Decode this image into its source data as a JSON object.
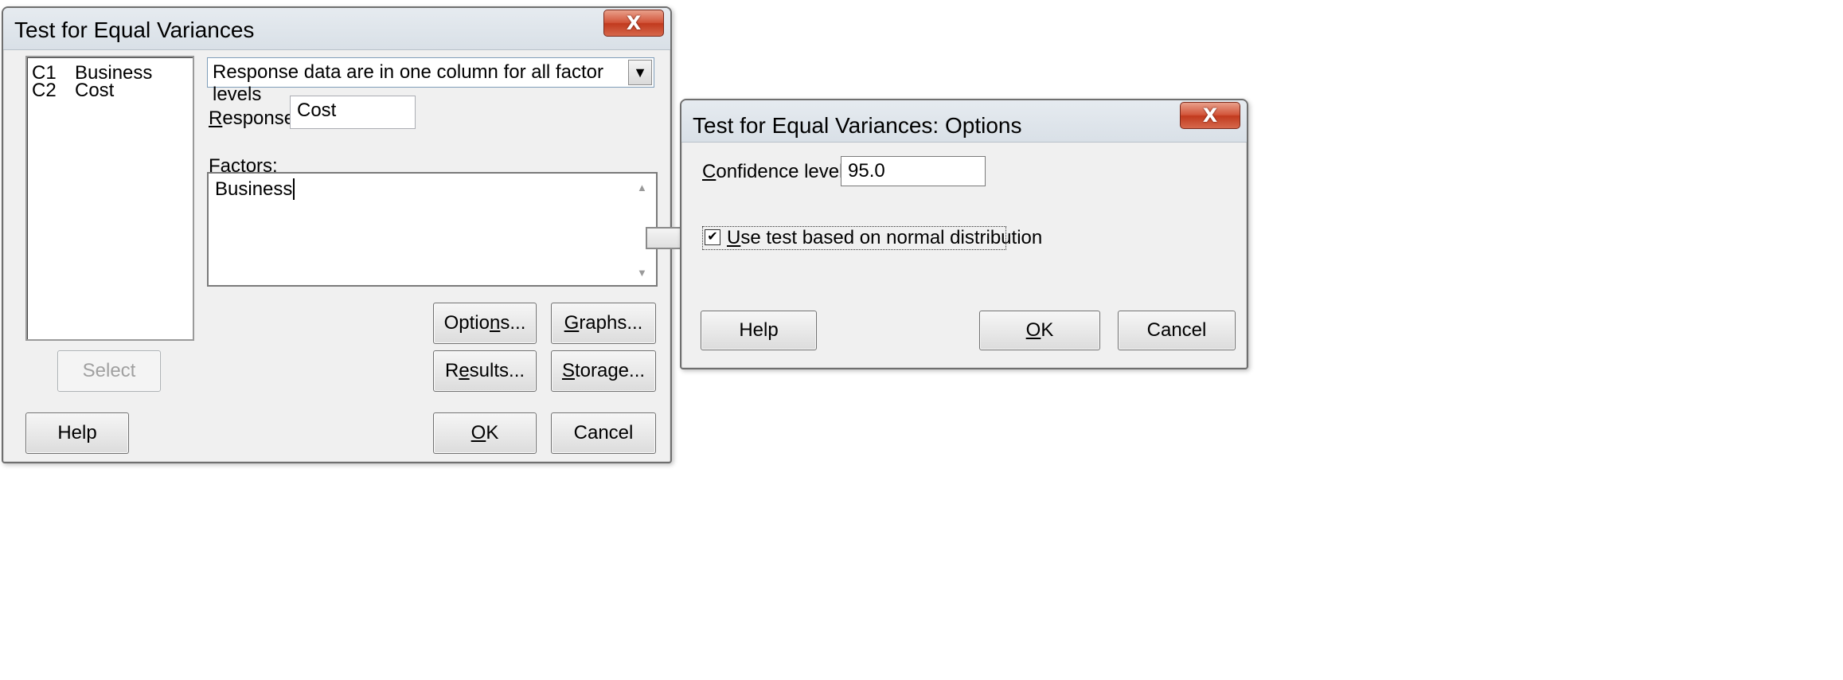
{
  "main_dialog": {
    "title": "Test for Equal Variances",
    "close_glyph": "X",
    "columns": [
      {
        "id": "C1",
        "name": "Business"
      },
      {
        "id": "C2",
        "name": "Cost"
      }
    ],
    "layout_select": {
      "value": "Response data are in one column for all factor levels",
      "arrow": "▼"
    },
    "response": {
      "label_key": "R",
      "label_rest": "esponse:",
      "value": "Cost"
    },
    "factors": {
      "label_key": "F",
      "label_rest": "actors:",
      "value": "Business"
    },
    "buttons": {
      "options": {
        "pre": "Optio",
        "key": "n",
        "post": "s..."
      },
      "graphs": {
        "pre": "",
        "key": "G",
        "post": "raphs..."
      },
      "results": {
        "pre": "R",
        "key": "e",
        "post": "sults..."
      },
      "storage": {
        "pre": "",
        "key": "S",
        "post": "torage..."
      },
      "select": "Select",
      "help": "Help",
      "ok": {
        "key": "O",
        "post": "K"
      },
      "cancel": "Cancel"
    },
    "scroll_up": "▲",
    "scroll_down": "▼"
  },
  "options_dialog": {
    "title": "Test for Equal Variances: Options",
    "close_glyph": "X",
    "confidence": {
      "label_key": "C",
      "label_rest": "onfidence level:",
      "value": "95.0"
    },
    "normal_checkbox": {
      "key": "U",
      "rest": "se test based on normal distribution",
      "checked": true,
      "check_glyph": "✔"
    },
    "buttons": {
      "help": "Help",
      "ok": {
        "key": "O",
        "post": "K"
      },
      "cancel": "Cancel"
    }
  },
  "arrow_icon": "right-arrow-icon"
}
